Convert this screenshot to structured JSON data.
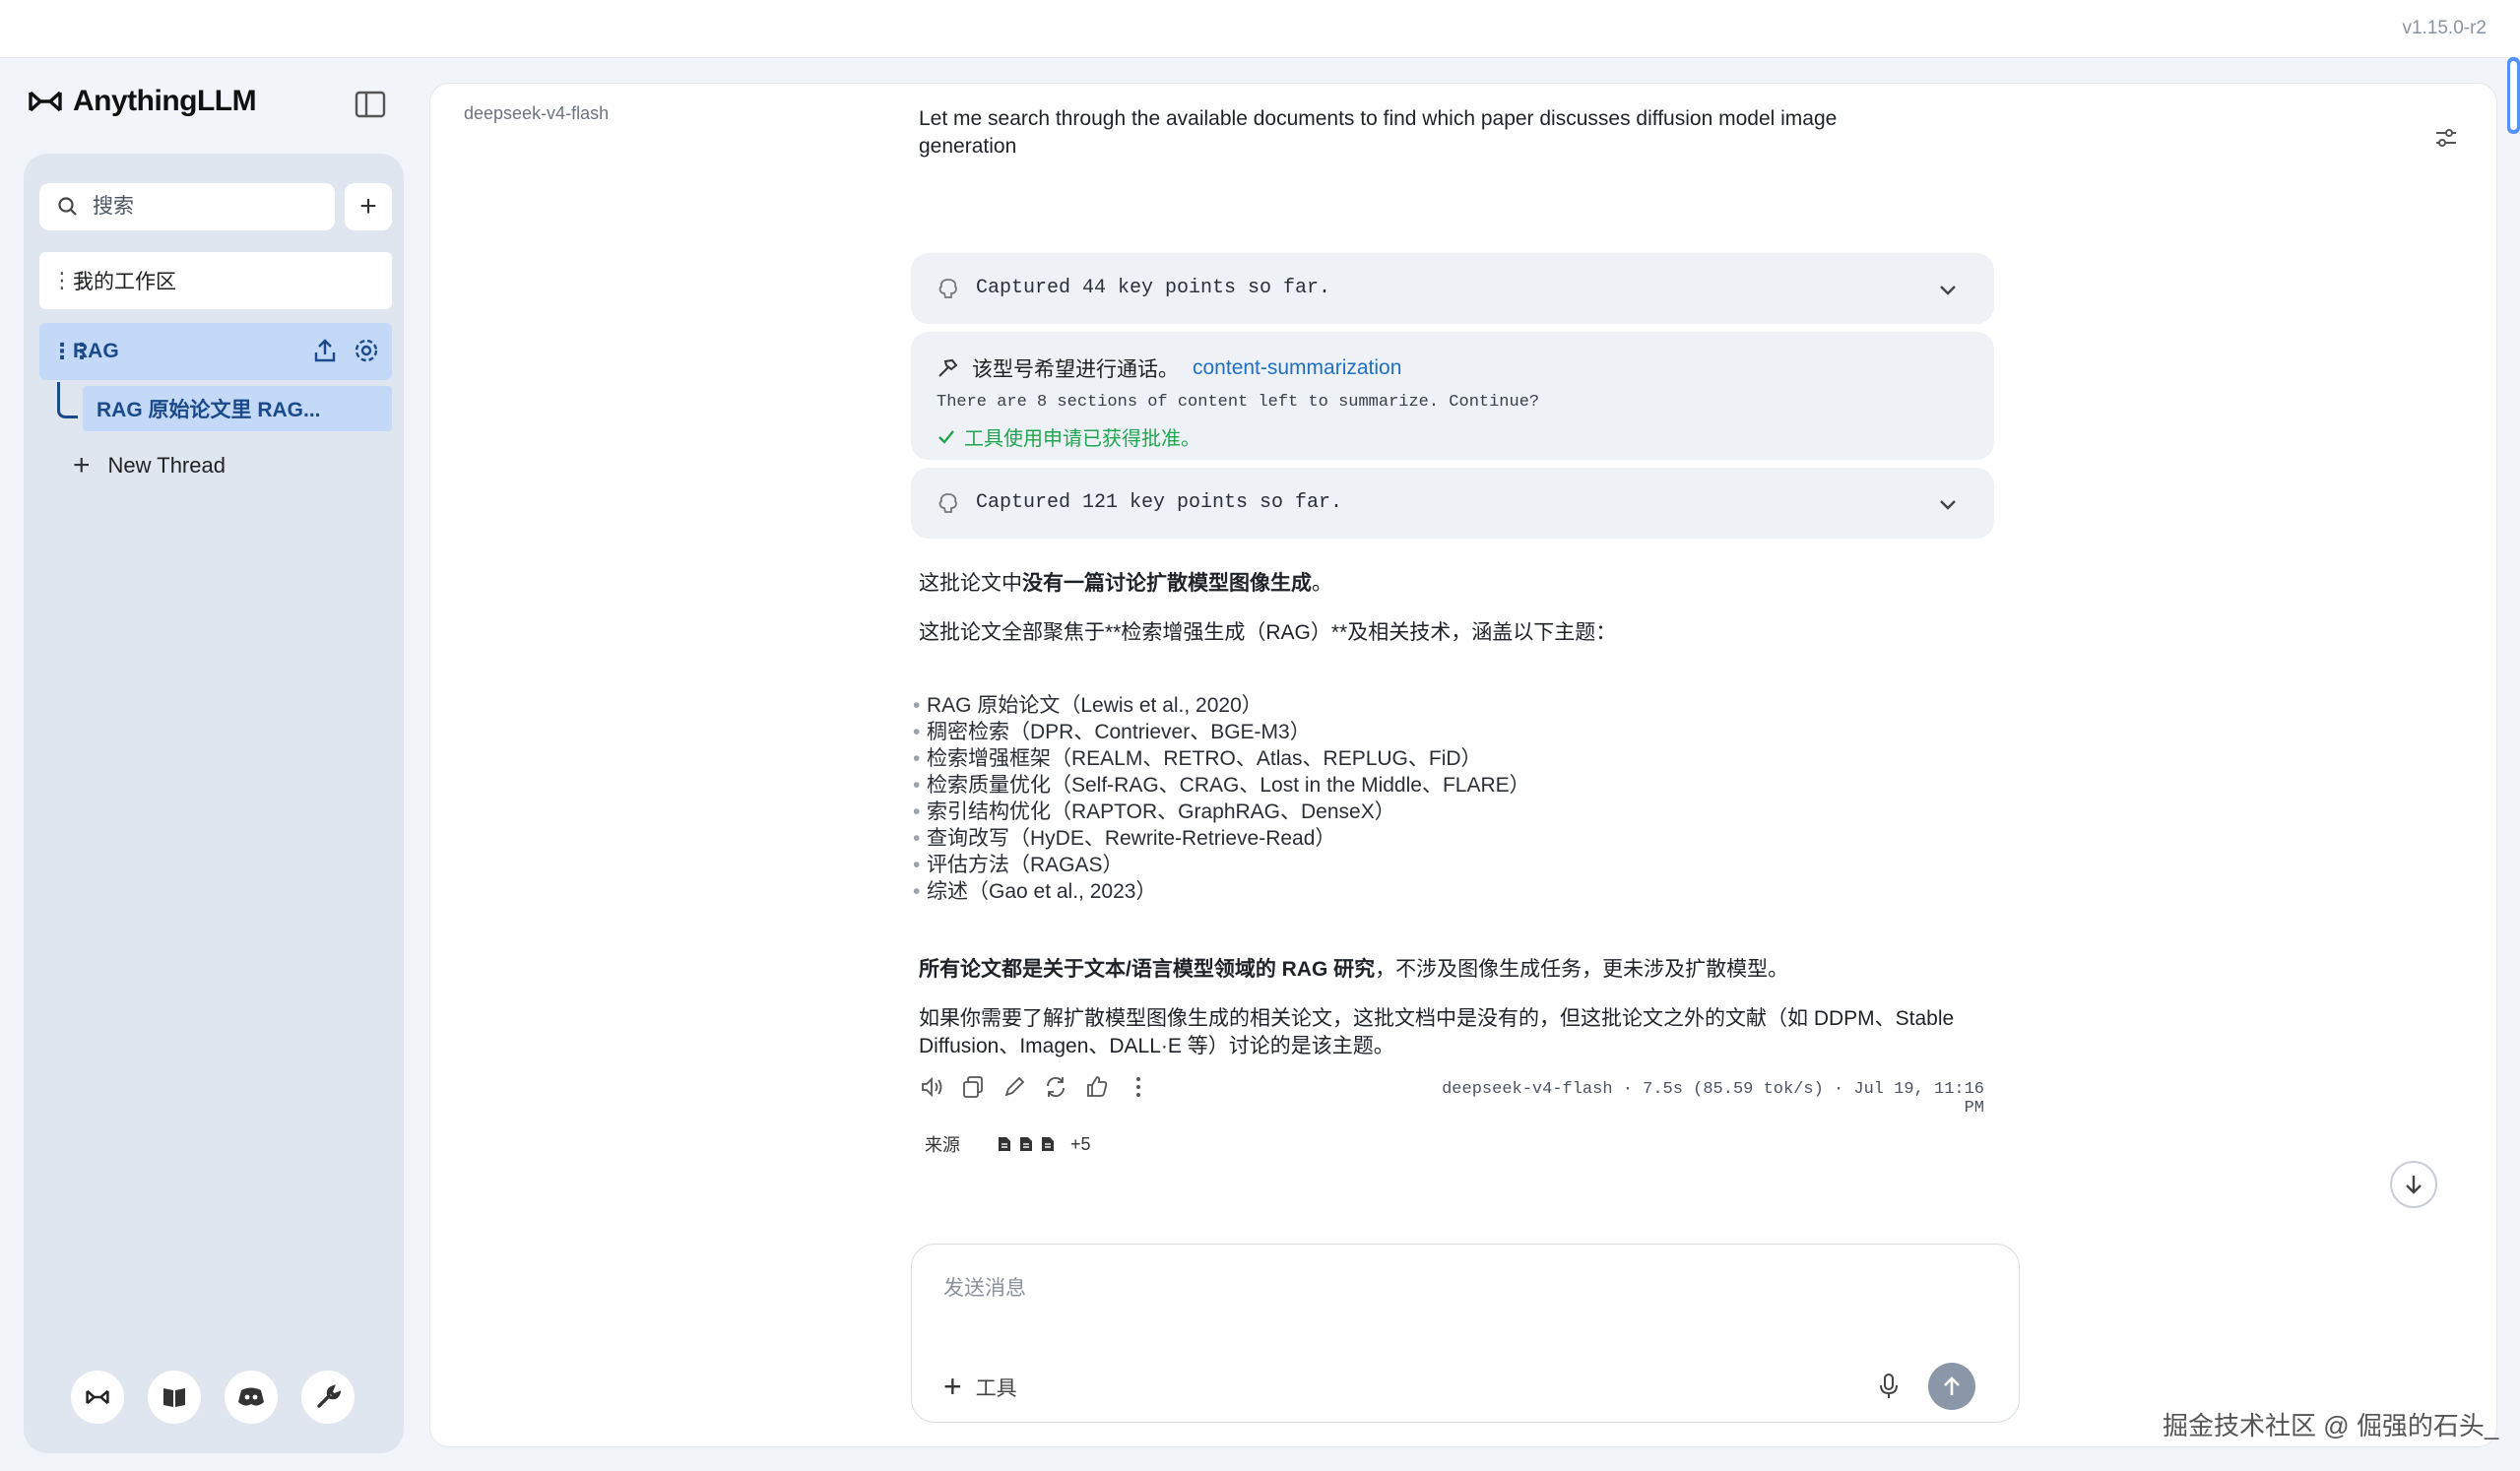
{
  "app": {
    "version": "v1.15.0-r2",
    "brand": "AnythingLLM"
  },
  "sidebar": {
    "search_placeholder": "搜索",
    "workspaces": [
      {
        "label": "我的工作区"
      },
      {
        "label": "RAG"
      }
    ],
    "thread": {
      "label": "RAG 原始论文里 RAG..."
    },
    "new_thread_label": "New Thread"
  },
  "chat": {
    "model": "deepseek-v4-flash",
    "intro": "Let me search through the available documents to find which paper discusses diffusion model image generation",
    "card1": "Captured 44 key points so far.",
    "tool": {
      "title": "该型号希望进行通话。",
      "name": "content-summarization",
      "desc": "There are 8 sections of content left to summarize. Continue?",
      "approved": "工具使用申请已获得批准。"
    },
    "card3": "Captured 121 key points so far.",
    "answer": {
      "p1_prefix": "这批论文中",
      "p1_bold": "没有一篇讨论扩散模型图像生成",
      "p1_suffix": "。",
      "p2": "这批论文全部聚焦于**检索增强生成（RAG）**及相关技术，涵盖以下主题：",
      "list": [
        "RAG 原始论文（Lewis et al., 2020）",
        "稠密检索（DPR、Contriever、BGE-M3）",
        "检索增强框架（REALM、RETRO、Atlas、REPLUG、FiD）",
        "检索质量优化（Self-RAG、CRAG、Lost in the Middle、FLARE）",
        "索引结构优化（RAPTOR、GraphRAG、DenseX）",
        "查询改写（HyDE、Rewrite-Retrieve-Read）",
        "评估方法（RAGAS）",
        "综述（Gao et al., 2023）"
      ],
      "p3_bold": "所有论文都是关于文本/语言模型领域的 RAG 研究",
      "p3_suffix": "，不涉及图像生成任务，更未涉及扩散模型。",
      "p4": "如果你需要了解扩散模型图像生成的相关论文，这批文档中是没有的，但这批论文之外的文献（如 DDPM、Stable Diffusion、Imagen、DALL·E 等）讨论的是该主题。"
    },
    "meta": "deepseek-v4-flash · 7.5s (85.59 tok/s) · Jul 19, 11:16 PM",
    "sources_label": "来源",
    "sources_more": "+5"
  },
  "composer": {
    "placeholder": "发送消息",
    "tools_label": "工具"
  },
  "watermark": "掘金技术社区 @ 倔强的石头_",
  "colors": {
    "accent": "#1f6fc5",
    "success": "#1fa650",
    "selected": "#c3d9f7",
    "sidebar_bg": "#dfe6ef"
  }
}
